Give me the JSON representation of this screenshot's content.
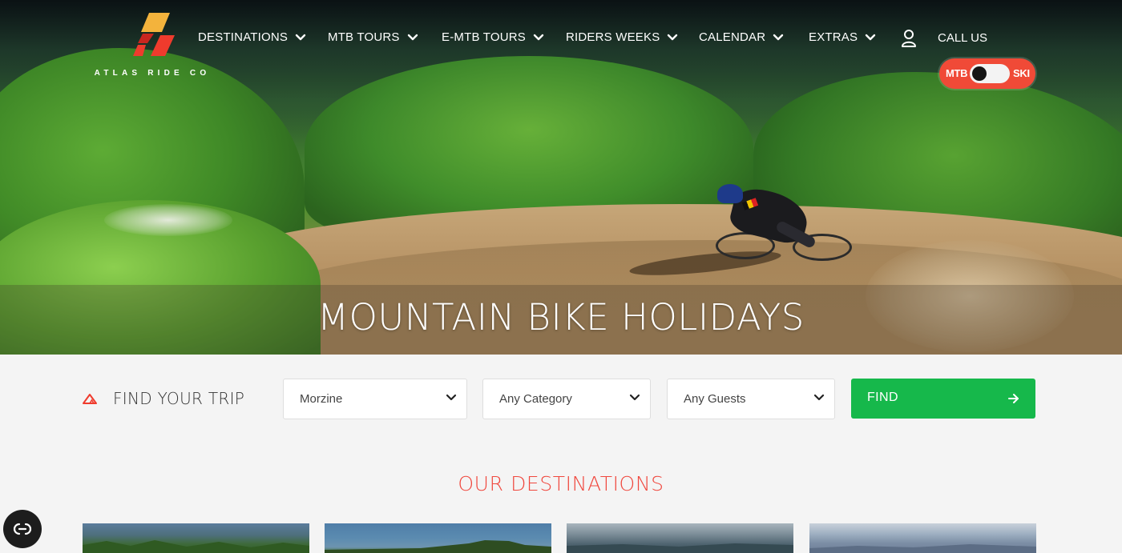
{
  "brand": {
    "name": "ATLAS RIDE CO",
    "colors": {
      "accent": "#f04a37",
      "logo_yellow": "#f3b33c",
      "find_green": "#16b84b",
      "title_red": "#f0473d"
    }
  },
  "nav": {
    "items": [
      {
        "label": "DESTINATIONS",
        "icon": "chevron-down-icon"
      },
      {
        "label": "MTB TOURS",
        "icon": "chevron-down-icon"
      },
      {
        "label": "E-MTB TOURS",
        "icon": "chevron-down-icon"
      },
      {
        "label": "RIDERS WEEKS",
        "icon": "chevron-down-icon"
      },
      {
        "label": "CALENDAR",
        "icon": "chevron-down-icon"
      },
      {
        "label": "EXTRAS",
        "icon": "chevron-down-icon"
      }
    ],
    "account_icon": "user-icon",
    "call_us": "CALL US"
  },
  "mode_toggle": {
    "left_label": "MTB",
    "right_label": "SKI",
    "selected": "MTB"
  },
  "hero": {
    "title": "MOUNTAIN BIKE HOLIDAYS"
  },
  "finder": {
    "label": "FIND YOUR TRIP",
    "icon": "mountain-icon",
    "destination": {
      "value": "Morzine"
    },
    "category": {
      "value": "Any Category"
    },
    "guests": {
      "value": "Any Guests"
    },
    "button": {
      "label": "FIND",
      "icon": "arrow-right-icon"
    }
  },
  "destinations": {
    "title": "OUR DESTINATIONS",
    "card_count": 4
  },
  "accessibility_button": {
    "icon": "accessibility-icon"
  }
}
